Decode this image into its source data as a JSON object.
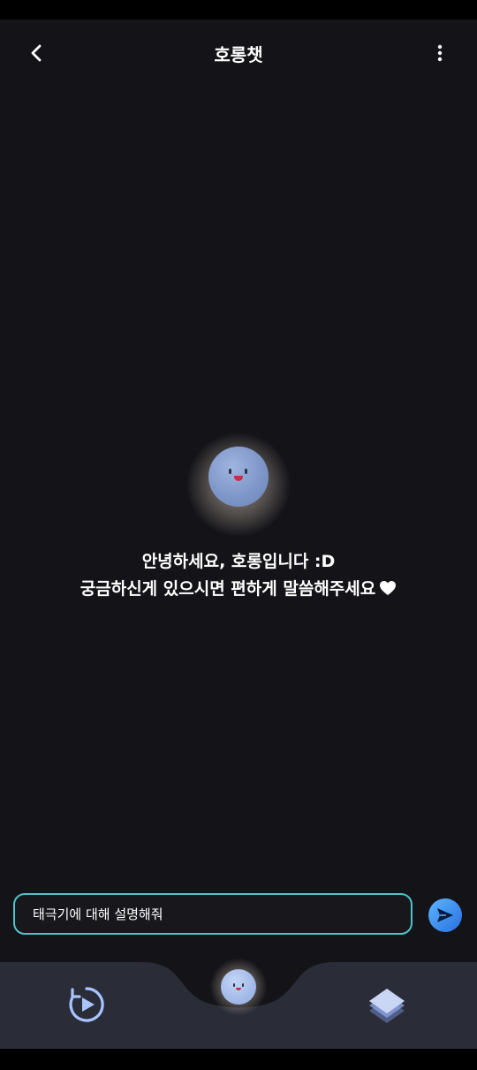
{
  "header": {
    "title": "호롱챗",
    "back_icon": "chevron-left-icon",
    "more_icon": "more-vertical-icon"
  },
  "greeting": {
    "line1": "안녕하세요, 호롱입니다 :D",
    "line2": "궁금하신게 있으시면 편하게 말씀해주세요",
    "heart_icon": "white-heart-icon"
  },
  "chat_input": {
    "value": "태극기에 대해 설명해줘",
    "send_icon": "send-icon"
  },
  "bottom_nav": {
    "left_icon": "replay-play-icon",
    "center_icon": "horong-mascot-icon",
    "right_icon": "layers-icon"
  },
  "colors": {
    "background": "#131318",
    "input_border": "#4fc3c8",
    "send_button": "#2a6fe0",
    "nav_background": "#2a2d38"
  }
}
